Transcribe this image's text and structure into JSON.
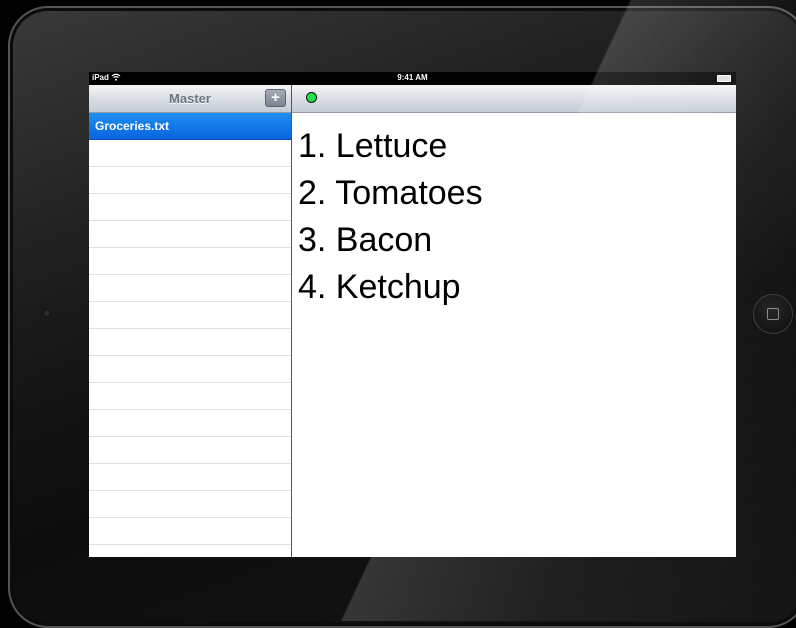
{
  "status_bar": {
    "carrier": "iPad",
    "time": "9:41 AM",
    "icons": [
      "wifi-icon",
      "battery-icon"
    ]
  },
  "master": {
    "title": "Master",
    "add_label": "+",
    "items": [
      {
        "label": "Groceries.txt",
        "selected": true
      },
      {
        "label": ""
      },
      {
        "label": ""
      },
      {
        "label": ""
      },
      {
        "label": ""
      },
      {
        "label": ""
      },
      {
        "label": ""
      },
      {
        "label": ""
      },
      {
        "label": ""
      },
      {
        "label": ""
      },
      {
        "label": ""
      },
      {
        "label": ""
      },
      {
        "label": ""
      },
      {
        "label": ""
      },
      {
        "label": ""
      },
      {
        "label": ""
      }
    ]
  },
  "detail": {
    "status_color": "#22e14a",
    "lines": [
      "1. Lettuce",
      "2. Tomatoes",
      "3. Bacon",
      "4. Ketchup"
    ]
  },
  "colors": {
    "selection": "#0a64e0",
    "bezel": "#0c0c0c"
  }
}
